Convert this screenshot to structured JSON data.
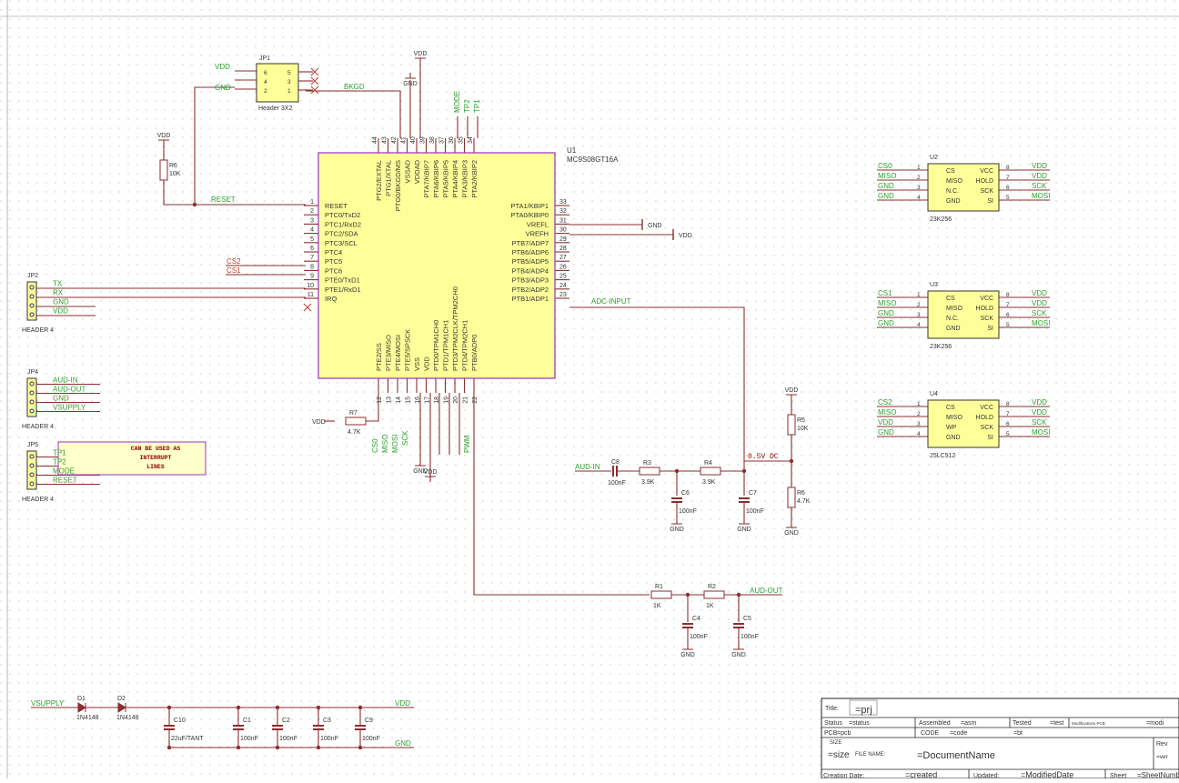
{
  "colors": {
    "wire": "#8b2e2e",
    "net": "#2ca02c",
    "label": "#333333",
    "chip": "#ffff99",
    "chip_border": "#9b30c8",
    "no_connect": "#c0392b",
    "note_text": "#8b0000"
  },
  "u1": {
    "ref": "U1",
    "part": "MC9S08GT16A",
    "top_pins": [
      {
        "num": "44",
        "name": "PTG2/EXTAL"
      },
      {
        "num": "43",
        "name": "PTG1/XTAL"
      },
      {
        "num": "42",
        "name": "PTG0/BKGD/MS"
      },
      {
        "num": "41",
        "name": "VSSAD"
      },
      {
        "num": "40",
        "name": "VDDAD"
      },
      {
        "num": "39",
        "name": "PTA7/KBIP7"
      },
      {
        "num": "38",
        "name": "PTA6/KBIP6"
      },
      {
        "num": "37",
        "name": "PTA5/KBIP5"
      },
      {
        "num": "36",
        "name": "PTA4/KBIP4"
      },
      {
        "num": "35",
        "name": "PTA3/KBIP3"
      },
      {
        "num": "34",
        "name": "PTA2/KBIP2"
      }
    ],
    "left_pins": [
      {
        "num": "1",
        "name": "RESET"
      },
      {
        "num": "2",
        "name": "PTC0/TxD2"
      },
      {
        "num": "3",
        "name": "PTC1/RxD2"
      },
      {
        "num": "4",
        "name": "PTC2/SDA"
      },
      {
        "num": "5",
        "name": "PTC3/SCL"
      },
      {
        "num": "6",
        "name": "PTC4"
      },
      {
        "num": "7",
        "name": "PTC5"
      },
      {
        "num": "8",
        "name": "PTC6"
      },
      {
        "num": "9",
        "name": "PTE0/TxD1"
      },
      {
        "num": "10",
        "name": "PTE1/RxD1"
      },
      {
        "num": "11",
        "name": "IRQ"
      }
    ],
    "right_pins": [
      {
        "num": "33",
        "name": "PTA1/KBIP1"
      },
      {
        "num": "32",
        "name": "PTA0/KBIP0"
      },
      {
        "num": "31",
        "name": "VREFL"
      },
      {
        "num": "30",
        "name": "VREFH"
      },
      {
        "num": "29",
        "name": "PTB7/ADP7"
      },
      {
        "num": "28",
        "name": "PTB6/ADP6"
      },
      {
        "num": "27",
        "name": "PTB5/ADP5"
      },
      {
        "num": "26",
        "name": "PTB4/ADP4"
      },
      {
        "num": "25",
        "name": "PTB3/ADP3"
      },
      {
        "num": "24",
        "name": "PTB2/ADP2"
      },
      {
        "num": "23",
        "name": "PTB1/ADP1"
      }
    ],
    "bottom_pins": [
      {
        "num": "12",
        "name": "PTE2/SS"
      },
      {
        "num": "13",
        "name": "PTE3/MISO"
      },
      {
        "num": "14",
        "name": "PTE4/MOSI"
      },
      {
        "num": "15",
        "name": "PTE5/SPSCK"
      },
      {
        "num": "16",
        "name": "VSS"
      },
      {
        "num": "17",
        "name": "VDD"
      },
      {
        "num": "18",
        "name": "PTD0/TPM1CH0"
      },
      {
        "num": "19",
        "name": "PTD1/TPM1CH1"
      },
      {
        "num": "20",
        "name": "PTD3/TPM2CLK/TPM2CH0"
      },
      {
        "num": "21",
        "name": "PTD4/TPM2CH1"
      },
      {
        "num": "22",
        "name": "PTB0/ADP0"
      }
    ]
  },
  "memories": [
    {
      "ref": "U2",
      "part": "23K256",
      "left": [
        {
          "num": "1",
          "name": "CS",
          "net": "CS0"
        },
        {
          "num": "2",
          "name": "MISO",
          "net": "MISO"
        },
        {
          "num": "3",
          "name": "N.C.",
          "net": "GND"
        },
        {
          "num": "4",
          "name": "GND",
          "net": "GND"
        }
      ],
      "right": [
        {
          "num": "8",
          "name": "VCC",
          "net": "VDD"
        },
        {
          "num": "7",
          "name": "HOLD",
          "net": "VDD"
        },
        {
          "num": "6",
          "name": "SCK",
          "net": "SCK"
        },
        {
          "num": "5",
          "name": "SI",
          "net": "MOSI"
        }
      ]
    },
    {
      "ref": "U3",
      "part": "23K256",
      "left": [
        {
          "num": "1",
          "name": "CS",
          "net": "CS1"
        },
        {
          "num": "2",
          "name": "MISO",
          "net": "MISO"
        },
        {
          "num": "3",
          "name": "N.C.",
          "net": "GND"
        },
        {
          "num": "4",
          "name": "GND",
          "net": "GND"
        }
      ],
      "right": [
        {
          "num": "8",
          "name": "VCC",
          "net": "VDD"
        },
        {
          "num": "7",
          "name": "HOLD",
          "net": "VDD"
        },
        {
          "num": "6",
          "name": "SCK",
          "net": "SCK"
        },
        {
          "num": "5",
          "name": "SI",
          "net": "MOSI"
        }
      ]
    },
    {
      "ref": "U4",
      "part": "25LC512",
      "left": [
        {
          "num": "1",
          "name": "CS",
          "net": "CS2"
        },
        {
          "num": "2",
          "name": "MISO",
          "net": "MISO"
        },
        {
          "num": "3",
          "name": "WP",
          "net": "VDD"
        },
        {
          "num": "4",
          "name": "GND",
          "net": "GND"
        }
      ],
      "right": [
        {
          "num": "8",
          "name": "VCC",
          "net": "VDD"
        },
        {
          "num": "7",
          "name": "HOLD",
          "net": "VDD"
        },
        {
          "num": "6",
          "name": "SCK",
          "net": "SCK"
        },
        {
          "num": "5",
          "name": "SI",
          "net": "MOSI"
        }
      ]
    }
  ],
  "jp1": {
    "ref": "JP1",
    "part": "Header 3X2",
    "pins_left": [
      "6",
      "4",
      "2"
    ],
    "pins_right": [
      "5",
      "3",
      "1"
    ],
    "net_vdd": "VDD",
    "net_gnd": "GND",
    "net_bkgd": "BKGD"
  },
  "jp2": {
    "ref": "JP2",
    "part": "HEADER 4",
    "nets": [
      "TX",
      "RX",
      "GND",
      "VDD"
    ]
  },
  "jp4": {
    "ref": "JP4",
    "part": "HEADER 4",
    "nets": [
      "AUD-IN",
      "AUD-OUT",
      "GND",
      "VSUPPLY"
    ]
  },
  "jp5": {
    "ref": "JP5",
    "part": "HEADER 4",
    "nets": [
      "TP1",
      "TP2",
      "MODE",
      "RESET"
    ],
    "note": [
      "CAN BE USED AS",
      "INTERRUPT",
      "LINES"
    ]
  },
  "nets": {
    "vdd": "VDD",
    "gnd": "GND",
    "reset": "RESET",
    "cs0": "CS0",
    "cs1": "CS1",
    "cs2": "CS2",
    "miso": "MISO",
    "mosi": "MOSI",
    "sck": "SCK",
    "pwm": "PWM",
    "mode": "MODE",
    "tp1": "TP1",
    "tp2": "TP2",
    "adc_input": "ADC-INPUT",
    "aud_in": "AUD-IN",
    "aud_out": "AUD-OUT",
    "half_vdc": "0.5V DC",
    "vsupply": "VSUPPLY"
  },
  "parts": {
    "r6a": {
      "ref": "R6",
      "val": "10K"
    },
    "r7": {
      "ref": "R7",
      "val": "4.7K"
    },
    "r3": {
      "ref": "R3",
      "val": "3.9K"
    },
    "r4": {
      "ref": "R4",
      "val": "3.9K"
    },
    "r5": {
      "ref": "R5",
      "val": "10K"
    },
    "r6b": {
      "ref": "R6",
      "val": "4.7K"
    },
    "c8": {
      "ref": "C8",
      "val": "100nF"
    },
    "c6": {
      "ref": "C6",
      "val": "100nF"
    },
    "c7": {
      "ref": "C7",
      "val": "100nF"
    },
    "r1": {
      "ref": "R1",
      "val": "1K"
    },
    "r2": {
      "ref": "R2",
      "val": "1K"
    },
    "c4": {
      "ref": "C4",
      "val": "100nF"
    },
    "c5": {
      "ref": "C5",
      "val": "100nF"
    },
    "d1": {
      "ref": "D1",
      "val": "1N4148"
    },
    "d2": {
      "ref": "D2",
      "val": "1N4148"
    },
    "c10": {
      "ref": "C10",
      "val": "22uF/TANT"
    },
    "c1": {
      "ref": "C1",
      "val": "100nF"
    },
    "c2": {
      "ref": "C2",
      "val": "100nF"
    },
    "c3": {
      "ref": "C3",
      "val": "100nF"
    },
    "c9": {
      "ref": "C9",
      "val": "100nF"
    }
  },
  "title_block": {
    "title_label": "Title:",
    "title_value": "=prj",
    "status_label": "Status",
    "status_value": "=status",
    "assembled_label": "Assembled",
    "assembled_value": "=asm",
    "tested_label": "Tested",
    "tested_value": "=test",
    "modif_label": "Modifications PCB",
    "modif_value": "=modi",
    "pcb_label": "PCB",
    "pcb_value": "=pcb",
    "code_label": "CODE",
    "code_value": "=code",
    "bt_value": "=bt",
    "size_label": "SIZE",
    "size_value": "=size",
    "filename_label": "FILE NAME:",
    "filename_value": "=DocumentName",
    "rev_label": "Rev",
    "rev_value": "=ver",
    "creation_label": "Creation Date:",
    "creation_value": "=created",
    "updated_label": "Updated:",
    "updated_value": "=ModifiedDate",
    "sheet_label": "Sheet",
    "sheet_value": "=SheetNumber"
  }
}
